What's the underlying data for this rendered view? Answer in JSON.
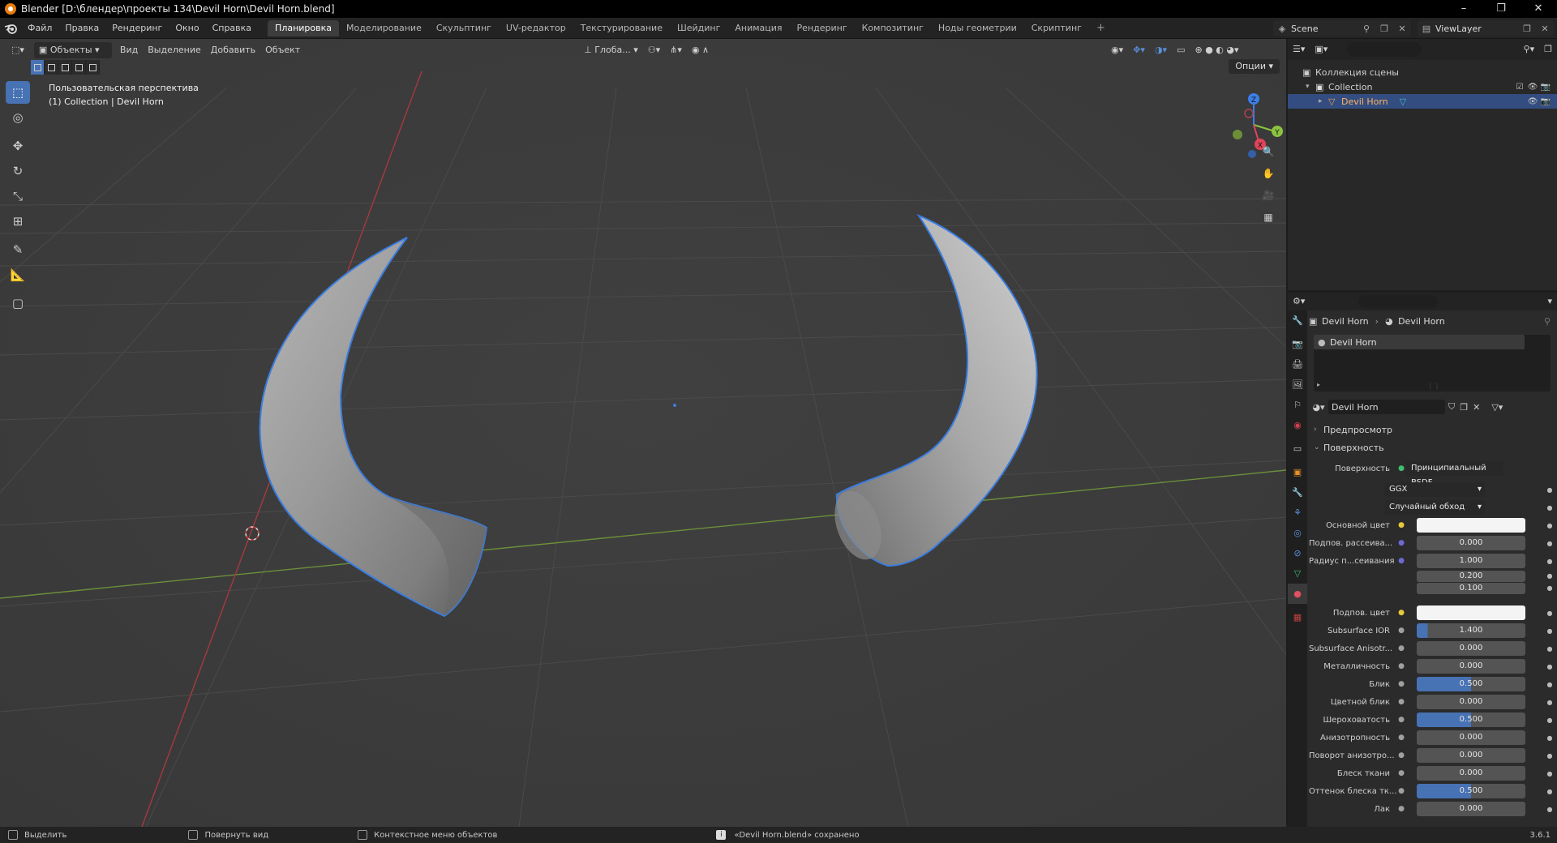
{
  "window": {
    "title": "Blender [D:\\блендер\\проекты 134\\Devil Horn\\Devil Horn.blend]",
    "controls": [
      "–",
      "❐",
      "✕"
    ]
  },
  "menu": {
    "items": [
      "Файл",
      "Правка",
      "Рендеринг",
      "Окно",
      "Справка"
    ],
    "workspaces": [
      "Планировка",
      "Моделирование",
      "Скульптинг",
      "UV-редактор",
      "Текстурирование",
      "Шейдинг",
      "Анимация",
      "Рендеринг",
      "Композитинг",
      "Ноды геометрии",
      "Скриптинг"
    ],
    "active_workspace": "Планировка",
    "add_tab": "+",
    "scene": "Scene",
    "view_layer": "ViewLayer"
  },
  "viewport": {
    "header": {
      "mode": "Объекты",
      "menus": [
        "Вид",
        "Выделение",
        "Добавить",
        "Объект"
      ],
      "transform_orientation": "Глоба...",
      "options": "Опции"
    },
    "overlay_line1": "Пользовательская перспектива",
    "overlay_line2": "(1) Collection | Devil Horn",
    "gizmo_axes": [
      "X",
      "Y",
      "Z"
    ],
    "tools": [
      "select-box-icon",
      "cursor-icon",
      "move-icon",
      "rotate-icon",
      "scale-icon",
      "transform-icon",
      "annotate-icon",
      "measure-icon",
      "add-cube-icon"
    ]
  },
  "outliner": {
    "root": "Коллекция сцены",
    "collection": "Collection",
    "object": "Devil Horn"
  },
  "properties": {
    "breadcrumb_object": "Devil Horn",
    "breadcrumb_material": "Devil Horn",
    "material_slot": "Devil Horn",
    "material_name": "Devil Horn",
    "panels": {
      "preview": "Предпросмотр",
      "surface": "Поверхность"
    },
    "surface_label": "Поверхность",
    "surface_shader": "Принципиальный BSDF",
    "distribution": "GGX",
    "subsurface_method": "Случайный обход",
    "rows": [
      {
        "label": "Основной цвет",
        "value": "",
        "kind": "white",
        "dot": "#e8c93a"
      },
      {
        "label": "Подпов. рассеива...",
        "value": "0.000",
        "kind": "plain",
        "dot": "#6b6bd6"
      },
      {
        "label": "Радиус п...сеивания",
        "value": "1.000",
        "kind": "plain",
        "dot": "#6b6bd6"
      },
      {
        "label": "",
        "value": "0.200",
        "kind": "plain",
        "dot": ""
      },
      {
        "label": "",
        "value": "0.100",
        "kind": "plain",
        "dot": ""
      },
      {
        "label": "Подпов. цвет",
        "value": "",
        "kind": "white",
        "dot": "#e8c93a"
      },
      {
        "label": "Subsurface IOR",
        "value": "1.400",
        "kind": "blue",
        "fill": 0.1,
        "dot": "#a0a0a0"
      },
      {
        "label": "Subsurface Anisotr...",
        "value": "0.000",
        "kind": "plain",
        "dot": "#a0a0a0"
      },
      {
        "label": "Металличность",
        "value": "0.000",
        "kind": "plain",
        "dot": "#a0a0a0"
      },
      {
        "label": "Блик",
        "value": "0.500",
        "kind": "blue",
        "fill": 0.5,
        "dot": "#a0a0a0"
      },
      {
        "label": "Цветной блик",
        "value": "0.000",
        "kind": "plain",
        "dot": "#a0a0a0"
      },
      {
        "label": "Шероховатость",
        "value": "0.500",
        "kind": "blue",
        "fill": 0.5,
        "dot": "#a0a0a0"
      },
      {
        "label": "Анизотропность",
        "value": "0.000",
        "kind": "plain",
        "dot": "#a0a0a0"
      },
      {
        "label": "Поворот анизотро...",
        "value": "0.000",
        "kind": "plain",
        "dot": "#a0a0a0"
      },
      {
        "label": "Блеск ткани",
        "value": "0.000",
        "kind": "plain",
        "dot": "#a0a0a0"
      },
      {
        "label": "Оттенок блеска тк...",
        "value": "0.500",
        "kind": "blue",
        "fill": 0.5,
        "dot": "#a0a0a0"
      },
      {
        "label": "Лак",
        "value": "0.000",
        "kind": "plain",
        "dot": "#a0a0a0"
      }
    ]
  },
  "statusbar": {
    "select": "Выделить",
    "rotate": "Повернуть вид",
    "context": "Контекстное меню объектов",
    "message": "«Devil Horn.blend» сохранено",
    "version": "3.6.1"
  },
  "colors": {
    "accent": "#4772b3",
    "selection_outline": "#3a7de0",
    "x_axis": "#e0445a",
    "y_axis": "#8bc43f",
    "z_axis": "#3c7ee8"
  }
}
